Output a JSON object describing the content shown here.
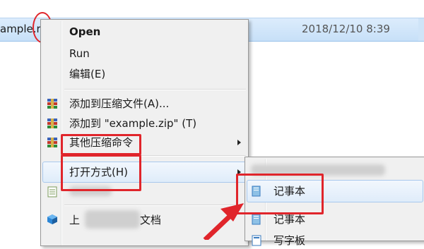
{
  "file_row": {
    "name": "ample.r",
    "date": "2018/12/10 8:39"
  },
  "context_menu": {
    "items": [
      {
        "label": "Open",
        "bold": true
      },
      {
        "label": "Run"
      },
      {
        "label": "编辑(E)"
      },
      {
        "label": "添加到压缩文件(A)..."
      },
      {
        "label": "添加到 \"example.zip\" (T)"
      },
      {
        "label": "其他压缩命令"
      },
      {
        "label": "打开方式(H)"
      },
      {
        "label": "上"
      },
      {
        "label": "文档"
      }
    ]
  },
  "submenu": {
    "items": [
      {
        "label": "记事本"
      },
      {
        "label": "记事本"
      },
      {
        "label": "写字板"
      }
    ]
  },
  "colors": {
    "annotation_red": "#e0252b",
    "selection_blue": "#cfe4f8"
  }
}
